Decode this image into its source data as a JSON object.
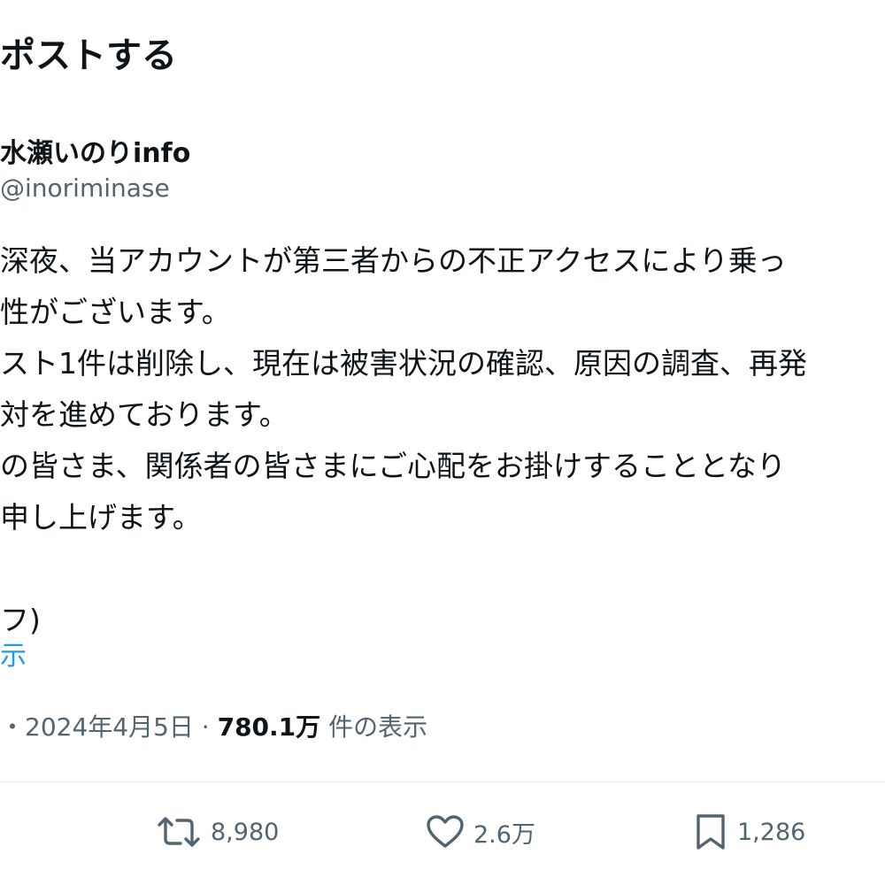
{
  "header": {
    "title": "ポストする"
  },
  "author": {
    "display_name": "水瀬いのりinfo",
    "handle": "@inoriminase"
  },
  "post": {
    "lines": [
      "深夜、当アカウントが第三者からの不正アクセスにより乗っ",
      "性がございます。",
      "スト1件は削除し、現在は被害状況の確認、原因の調査、再発",
      "対を進めております。",
      "の皆さま、関係者の皆さまにご心配をお掛けすることとなり",
      "申し上げます。",
      "",
      "フ)"
    ],
    "translate_label": "示"
  },
  "meta": {
    "prefix": "・2024年4月5日 · ",
    "views_count": "780.1万",
    "views_label": " 件の表示"
  },
  "actions": {
    "retweets": "8,980",
    "likes": "2.6万",
    "bookmarks": "1,286",
    "icon_color": "#536471"
  }
}
